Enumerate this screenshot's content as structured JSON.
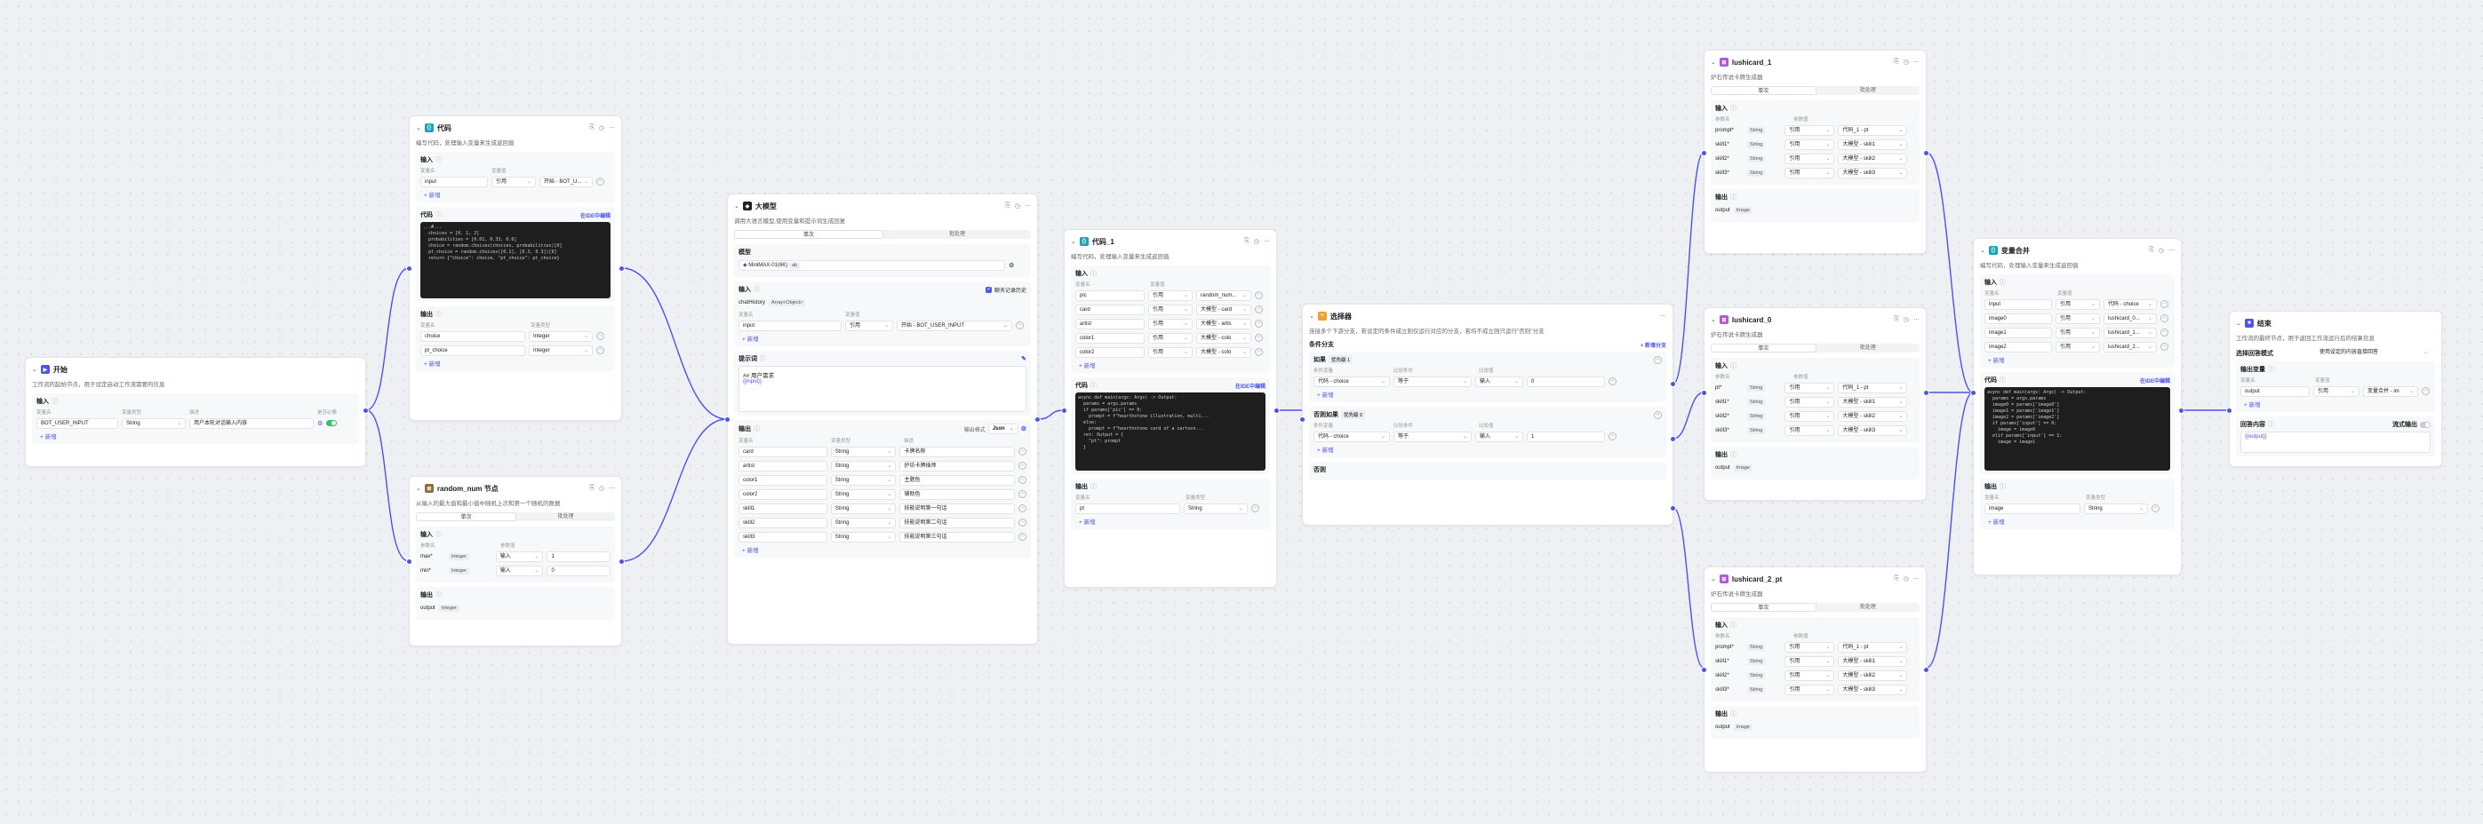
{
  "common": {
    "add": "新增",
    "input": "输入",
    "output": "输出",
    "var_name": "变量名",
    "var_value": "变量值",
    "var_type": "变量类型",
    "param_name": "参数名",
    "param_value": "参数值",
    "desc": "描述",
    "ref": "引用",
    "tab_single": "单次",
    "tab_batch": "批处理",
    "edit_in_ide": "在IDE中编辑",
    "code": "代码"
  },
  "start": {
    "title": "开始",
    "desc": "工作流的起始节点，用于设定启动工作流需要的信息",
    "row": {
      "name": "BOT_USER_INPUT",
      "type": "String",
      "desc": "用户本轮对话输入内容"
    },
    "required": "是否必要"
  },
  "code1": {
    "title": "代码",
    "desc": "编写代码，处理输入变量来生成返回值",
    "in": {
      "name": "input",
      "mode": "引用",
      "value": "开始 - BOT_U..."
    },
    "lines": [
      "...#...",
      "  choices = [0, 1, 2]",
      "  probabilities = [0.01, 0.33, 0.6]",
      "  choice = random.choices(choices, probabilities)[0]",
      "",
      "  pt_choice = random.choices([0,1], [0.3, 0.3])[0]",
      "  return {\"choice\": choice, \"pt_choice\": pt_choice}"
    ],
    "outs": [
      {
        "name": "choice",
        "type": "Integer"
      },
      {
        "name": "pt_choice",
        "type": "Integer"
      }
    ]
  },
  "random": {
    "title": "random_num 节点",
    "desc": "从输入的最大值和最小值中随机上次和第一个随机的数据",
    "ins": [
      {
        "name": "max*",
        "type": "Integer",
        "mode": "输入",
        "value": "1"
      },
      {
        "name": "min*",
        "type": "Integer",
        "mode": "输入",
        "value": "0"
      }
    ],
    "out_name": "output",
    "out_type": "Integer"
  },
  "llm": {
    "title": "大模型",
    "desc": "调用大语言模型,使用变量和提示词生成回复",
    "model_label": "模型",
    "model": "MiniMAX-01(6K)",
    "model_tag": "ab",
    "batch": "批处理",
    "history": "chatHistory",
    "history_type": "Array<Object>",
    "chat_label": "聊天记录历史",
    "in": {
      "name": "input",
      "mode": "引用",
      "value": "开始 - BOT_USER_INPUT"
    },
    "prompt_label": "提示词",
    "prompt_line1": "## 用户需求",
    "prompt_line2": "{{input}}",
    "out_fmt": "输出格式",
    "out_fmt_value": "Json",
    "outs": [
      {
        "name": "card",
        "type": "String",
        "desc": "卡牌名称"
      },
      {
        "name": "artist",
        "type": "String",
        "desc": "护坊卡牌插师"
      },
      {
        "name": "color1",
        "type": "String",
        "desc": "主题色"
      },
      {
        "name": "color2",
        "type": "String",
        "desc": "辅助色"
      },
      {
        "name": "skill1",
        "type": "String",
        "desc": "技能说明第一句话"
      },
      {
        "name": "skill2",
        "type": "String",
        "desc": "技能说明第二句话"
      },
      {
        "name": "skill3",
        "type": "String",
        "desc": "技能说明第三句话"
      }
    ]
  },
  "code2": {
    "title": "代码_1",
    "desc": "编写代码，处理输入变量来生成返回值",
    "ins": [
      {
        "name": "pic",
        "mode": "引用",
        "value": "random_num..."
      },
      {
        "name": "card",
        "mode": "引用",
        "value": "大模型 - card"
      },
      {
        "name": "artist",
        "mode": "引用",
        "value": "大模型 - artis"
      },
      {
        "name": "color1",
        "mode": "引用",
        "value": "大模型 - colo"
      },
      {
        "name": "color2",
        "mode": "引用",
        "value": "大模型 - colo"
      }
    ],
    "lines": [
      "async def main(args: Args) -> Output:",
      "  params = args.params",
      "  if params['pic'] == 0:",
      "    prompt = f\"hearthstone illustration, multi...",
      "  else:",
      "    prompt = f\"hearthstone card of a cartoon...",
      "",
      "  ret: Output = {",
      "    \"pt\": prompt",
      "  }"
    ],
    "out": {
      "name": "pt",
      "type": "String"
    }
  },
  "cond": {
    "title": "选择器",
    "desc": "连接多个下游分支，若设定的条件成立则仅运行对应的分支，若均不成立则只运行\"否则\"分支",
    "branch_label": "条件分支",
    "add_branch": "新增分支",
    "if_label": "如果",
    "else_if_label": "否则如果",
    "prio1": "优先级 1",
    "prio2": "优先级 2",
    "col_var": "条件变量",
    "col_op": "比较条件",
    "col_val": "比较值",
    "r1": {
      "var": "代码 - choice",
      "op": "等于",
      "mode": "输入",
      "val": "0"
    },
    "r2": {
      "var": "代码 - choice",
      "op": "等于",
      "mode": "输入",
      "val": "1"
    },
    "else_label": "否则"
  },
  "lc1": {
    "title": "lushicard_1",
    "desc": "炉石传说卡牌生成器",
    "ins": [
      {
        "name": "prompt*",
        "type": "String",
        "mode": "引用",
        "value": "代码_1 - pt"
      },
      {
        "name": "skill1*",
        "type": "String",
        "mode": "引用",
        "value": "大模型 - skill1"
      },
      {
        "name": "skill2*",
        "type": "String",
        "mode": "引用",
        "value": "大模型 - skill2"
      },
      {
        "name": "skill3*",
        "type": "String",
        "mode": "引用",
        "value": "大模型 - skill3"
      }
    ],
    "out_name": "output",
    "out_type": "Image"
  },
  "lc0": {
    "title": "lushicard_0",
    "desc": "炉石传说卡牌生成器",
    "ins": [
      {
        "name": "pt*",
        "type": "String",
        "mode": "引用",
        "value": "代码_1 - pt"
      },
      {
        "name": "skill1*",
        "type": "String",
        "mode": "引用",
        "value": "大模型 - skill1"
      },
      {
        "name": "skill2*",
        "type": "String",
        "mode": "引用",
        "value": "大模型 - skill2"
      },
      {
        "name": "skill3*",
        "type": "String",
        "mode": "引用",
        "value": "大模型 - skill3"
      }
    ],
    "out_name": "output",
    "out_type": "Image"
  },
  "lc2": {
    "title": "lushicard_2_pt",
    "desc": "炉石传说卡牌生成器",
    "ins": [
      {
        "name": "prompt*",
        "type": "String",
        "mode": "引用",
        "value": "代码_1 - pt"
      },
      {
        "name": "skill1*",
        "type": "String",
        "mode": "引用",
        "value": "大模型 - skill1"
      },
      {
        "name": "skill2*",
        "type": "String",
        "mode": "引用",
        "value": "大模型 - skill2"
      },
      {
        "name": "skill3*",
        "type": "String",
        "mode": "引用",
        "value": "大模型 - skill3"
      }
    ],
    "out_name": "output",
    "out_type": "Image"
  },
  "merge": {
    "title": "变量合并",
    "desc": "编写代码，处理输入变量来生成返回值",
    "ins": [
      {
        "name": "input",
        "mode": "引用",
        "value": "代码 - choice"
      },
      {
        "name": "image0",
        "mode": "引用",
        "value": "lushicard_0..."
      },
      {
        "name": "image1",
        "mode": "引用",
        "value": "lushicard_1..."
      },
      {
        "name": "image2",
        "mode": "引用",
        "value": "lushicard_2..."
      }
    ],
    "lines": [
      "async def main(args: Args) -> Output:",
      "  params = args.params",
      "  image0 = params['image0']",
      "  image1 = params['image1']",
      "  image2 = params['image2']",
      "",
      "  if params['input'] == 0:",
      "    image = image0",
      "  elif params['input'] == 1:",
      "    image = image1"
    ],
    "out": {
      "name": "image",
      "type": "String"
    }
  },
  "end": {
    "title": "结束",
    "desc": "工作流的最终节点，用于返回工作流运行后的结果信息",
    "mode_label": "选择回答模式",
    "mode_value": "使用设定的内容直接回答",
    "out_var": "输出变量",
    "out": {
      "name": "output",
      "mode": "引用",
      "value": "变量合并 - im"
    },
    "reply": "回答内容",
    "stream": "流式输出",
    "tpl": "{{output}}"
  }
}
